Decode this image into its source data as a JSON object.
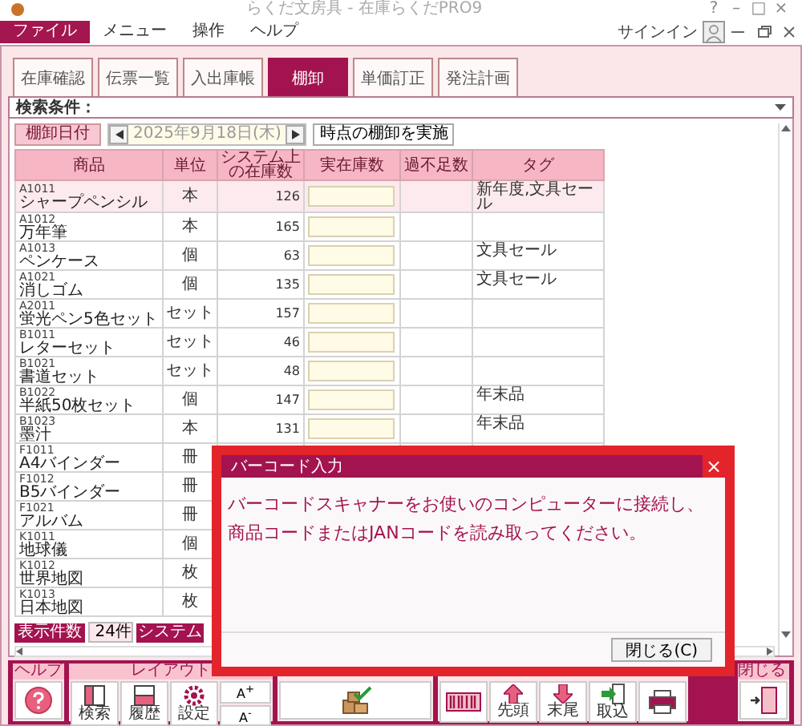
{
  "window": {
    "title": "らくだ文房具 - 在庫らくだPRO9",
    "buttons": [
      "?",
      "–",
      "□",
      "×"
    ]
  },
  "menu": {
    "items": [
      {
        "label": "ファイル",
        "selected": true
      },
      {
        "label": "メニュー",
        "selected": false
      },
      {
        "label": "操作",
        "selected": false
      },
      {
        "label": "ヘルプ",
        "selected": false
      }
    ],
    "sign_in": "サインイン"
  },
  "tabs": [
    {
      "label": "在庫確認",
      "selected": false
    },
    {
      "label": "伝票一覧",
      "selected": false
    },
    {
      "label": "入出庫帳",
      "selected": false
    },
    {
      "label": "棚卸",
      "selected": true
    },
    {
      "label": "単価訂正",
      "selected": false
    },
    {
      "label": "発注計画",
      "selected": false
    }
  ],
  "search": {
    "label": "検索条件："
  },
  "stocktake": {
    "date_label": "棚卸日付",
    "date": "2025年9月18日(木)",
    "run_button": "時点の棚卸を実施"
  },
  "table": {
    "columns": [
      "商品",
      "単位",
      "システム上の在庫数",
      "実在庫数",
      "過不足数",
      "タグ"
    ],
    "rows": [
      {
        "code": "A1011",
        "name": "シャープペンシル",
        "unit": "本",
        "system_stock": "126",
        "tag": "新年度,文具セール",
        "selected": true
      },
      {
        "code": "A1012",
        "name": "万年筆",
        "unit": "本",
        "system_stock": "165",
        "selected": false
      },
      {
        "code": "A1013",
        "name": "ペンケース",
        "unit": "個",
        "system_stock": "63",
        "tag": "文具セール",
        "selected": false
      },
      {
        "code": "A1021",
        "name": "消しゴム",
        "unit": "個",
        "system_stock": "135",
        "tag": "文具セール",
        "selected": false
      },
      {
        "code": "A2011",
        "name": "蛍光ペン5色セット",
        "unit": "セット",
        "system_stock": "157",
        "selected": false
      },
      {
        "code": "B1011",
        "name": "レターセット",
        "unit": "セット",
        "system_stock": "46",
        "selected": false
      },
      {
        "code": "B1021",
        "name": "書道セット",
        "unit": "セット",
        "system_stock": "48",
        "selected": false
      },
      {
        "code": "B1022",
        "name": "半紙50枚セット",
        "unit": "個",
        "system_stock": "147",
        "tag": "年末品",
        "selected": false
      },
      {
        "code": "B1023",
        "name": "墨汁",
        "unit": "本",
        "system_stock": "131",
        "tag": "年末品",
        "selected": false
      },
      {
        "code": "F1011",
        "name": "A4バインダー",
        "unit": "冊",
        "selected": false
      },
      {
        "code": "F1012",
        "name": "B5バインダー",
        "unit": "冊",
        "selected": false
      },
      {
        "code": "F1021",
        "name": "アルバム",
        "unit": "冊",
        "selected": false
      },
      {
        "code": "K1011",
        "name": "地球儀",
        "unit": "個",
        "selected": false
      },
      {
        "code": "K1012",
        "name": "世界地図",
        "unit": "枚",
        "selected": false
      },
      {
        "code": "K1013",
        "name": "日本地図",
        "unit": "枚",
        "selected": false
      }
    ]
  },
  "footer": {
    "count_label": "表示件数",
    "count": "24件",
    "system_label": "システム"
  },
  "toolbar": {
    "groups": [
      {
        "label": "ヘルプ",
        "buttons": [
          {
            "kind": "help"
          }
        ]
      },
      {
        "label": "レイアウト",
        "buttons": [
          {
            "kind": "search",
            "label": "検索"
          },
          {
            "kind": "history",
            "label": "履歴"
          },
          {
            "kind": "settings",
            "label": "設定"
          },
          {
            "kind": "font",
            "label": "A$^{+}$",
            "label_2": "A$^{-}$"
          }
        ]
      },
      {
        "buttons": [
          {
            "kind": "stock"
          }
        ]
      },
      {
        "buttons": [
          {
            "kind": "barcode"
          },
          {
            "kind": "first",
            "label": "先頭"
          },
          {
            "kind": "last",
            "label": "末尾"
          },
          {
            "kind": "import",
            "label": "取込"
          },
          {
            "kind": "print"
          }
        ]
      },
      {
        "label": "閉じる",
        "buttons": [
          {
            "kind": "exit"
          }
        ]
      }
    ]
  },
  "dialog": {
    "title": "バーコード入力",
    "close": "×",
    "message": [
      "バーコードスキャナーをお使いのコンピューターに接続し、",
      "商品コードまたはJANコードを読み取ってください。"
    ],
    "button": "閉じる(C)"
  }
}
